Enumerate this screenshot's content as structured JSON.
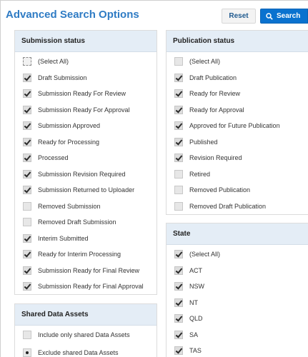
{
  "header": {
    "title": "Advanced Search Options",
    "reset_label": "Reset",
    "search_label": "Search"
  },
  "submission_status": {
    "title": "Submission status",
    "items": [
      {
        "label": "(Select All)",
        "checked": false
      },
      {
        "label": "Draft Submission",
        "checked": true
      },
      {
        "label": "Submission Ready For Review",
        "checked": true
      },
      {
        "label": "Submission Ready For Approval",
        "checked": true
      },
      {
        "label": "Submission Approved",
        "checked": true
      },
      {
        "label": "Ready for Processing",
        "checked": true
      },
      {
        "label": "Processed",
        "checked": true
      },
      {
        "label": "Submission Revision Required",
        "checked": true
      },
      {
        "label": "Submission Returned to Uploader",
        "checked": true
      },
      {
        "label": "Removed Submission",
        "checked": false
      },
      {
        "label": "Removed Draft Submission",
        "checked": false
      },
      {
        "label": "Interim Submitted",
        "checked": true
      },
      {
        "label": "Ready for Interim Processing",
        "checked": true
      },
      {
        "label": "Submission Ready for Final Review",
        "checked": true
      },
      {
        "label": "Submission Ready for Final Approval",
        "checked": true
      }
    ]
  },
  "publication_status": {
    "title": "Publication status",
    "items": [
      {
        "label": "(Select All)",
        "checked": false
      },
      {
        "label": "Draft Publication",
        "checked": true
      },
      {
        "label": "Ready for Review",
        "checked": true
      },
      {
        "label": "Ready for Approval",
        "checked": true
      },
      {
        "label": "Approved for Future Publication",
        "checked": true
      },
      {
        "label": "Published",
        "checked": true
      },
      {
        "label": "Revision Required",
        "checked": true
      },
      {
        "label": "Retired",
        "checked": false
      },
      {
        "label": "Removed Publication",
        "checked": false
      },
      {
        "label": "Removed Draft Publication",
        "checked": false
      }
    ]
  },
  "shared_data_assets": {
    "title": "Shared Data Assets",
    "items": [
      {
        "label": "Include only shared Data Assets",
        "selected": false
      },
      {
        "label": "Exclude shared Data Assets",
        "selected": true
      }
    ]
  },
  "state": {
    "title": "State",
    "items": [
      {
        "label": "(Select All)",
        "checked": true
      },
      {
        "label": "ACT",
        "checked": true
      },
      {
        "label": "NSW",
        "checked": true
      },
      {
        "label": "NT",
        "checked": true
      },
      {
        "label": "QLD",
        "checked": true
      },
      {
        "label": "SA",
        "checked": true
      },
      {
        "label": "TAS",
        "checked": true
      }
    ]
  },
  "icons": {
    "search": "search-icon"
  }
}
